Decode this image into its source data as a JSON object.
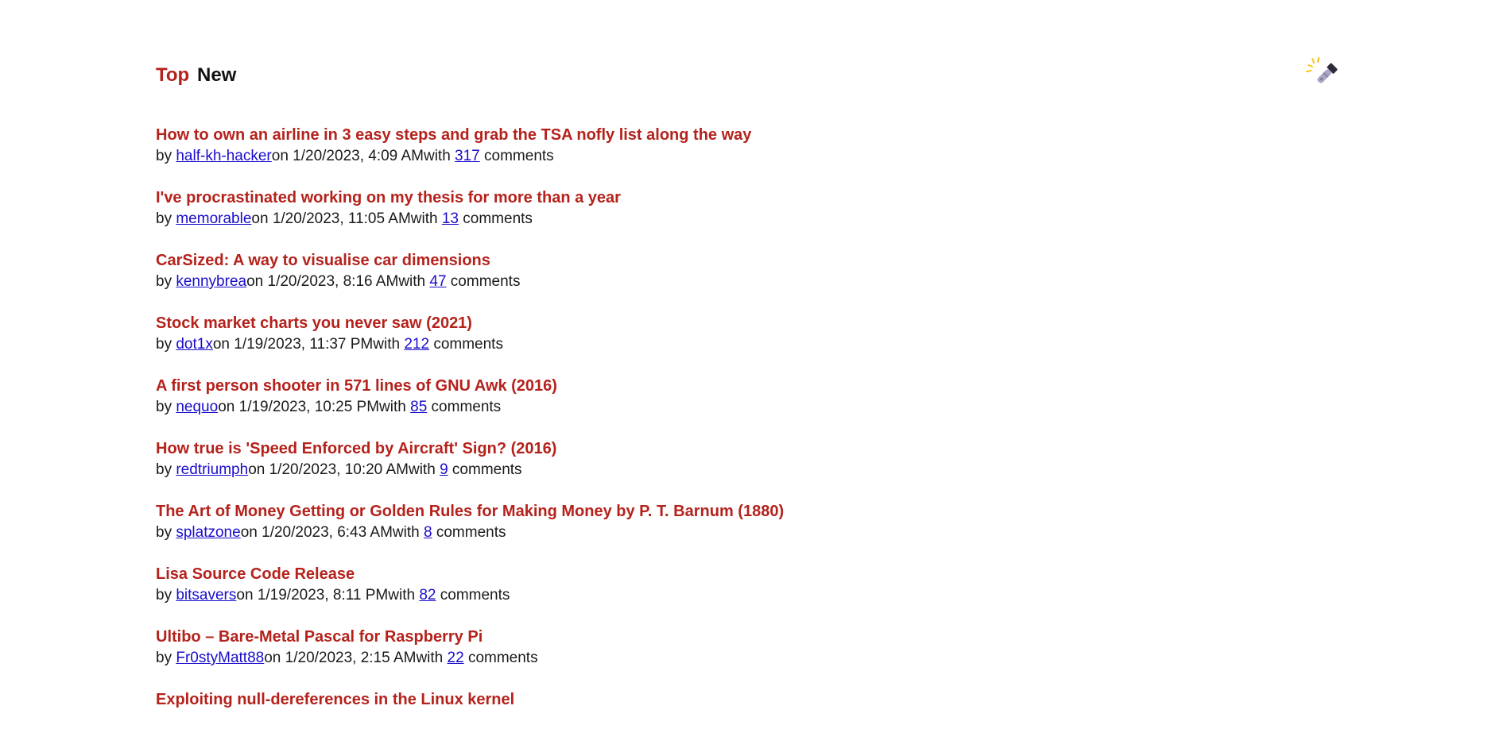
{
  "nav": {
    "tabs": [
      {
        "label": "Top",
        "active": true
      },
      {
        "label": "New",
        "active": false
      }
    ],
    "theme_toggle_icon": "flashlight-icon"
  },
  "meta_labels": {
    "by": "by ",
    "on": "on ",
    "with": "with ",
    "comments": " comments"
  },
  "colors": {
    "title": "#b5221c",
    "link": "#1a0dcc",
    "text": "#1a1a1a"
  },
  "stories": [
    {
      "title": "How to own an airline in 3 easy steps and grab the TSA nofly list along the way",
      "author": "half-kh-hacker",
      "date": "1/20/2023, 4:09 AM",
      "comments": "317"
    },
    {
      "title": "I've procrastinated working on my thesis for more than a year",
      "author": "memorable",
      "date": "1/20/2023, 11:05 AM",
      "comments": "13"
    },
    {
      "title": "CarSized: A way to visualise car dimensions",
      "author": "kennybrea",
      "date": "1/20/2023, 8:16 AM",
      "comments": "47"
    },
    {
      "title": "Stock market charts you never saw (2021)",
      "author": "dot1x",
      "date": "1/19/2023, 11:37 PM",
      "comments": "212"
    },
    {
      "title": "A first person shooter in 571 lines of GNU Awk (2016)",
      "author": "nequo",
      "date": "1/19/2023, 10:25 PM",
      "comments": "85"
    },
    {
      "title": "How true is 'Speed Enforced by Aircraft' Sign? (2016)",
      "author": "redtriumph",
      "date": "1/20/2023, 10:20 AM",
      "comments": "9"
    },
    {
      "title": "The Art of Money Getting or Golden Rules for Making Money by P. T. Barnum (1880)",
      "author": "splatzone",
      "date": "1/20/2023, 6:43 AM",
      "comments": "8"
    },
    {
      "title": "Lisa Source Code Release",
      "author": "bitsavers",
      "date": "1/19/2023, 8:11 PM",
      "comments": "82"
    },
    {
      "title": "Ultibo – Bare-Metal Pascal for Raspberry Pi",
      "author": "Fr0styMatt88",
      "date": "1/20/2023, 2:15 AM",
      "comments": "22"
    },
    {
      "title": "Exploiting null-dereferences in the Linux kernel",
      "author": "",
      "date": "",
      "comments": ""
    }
  ]
}
